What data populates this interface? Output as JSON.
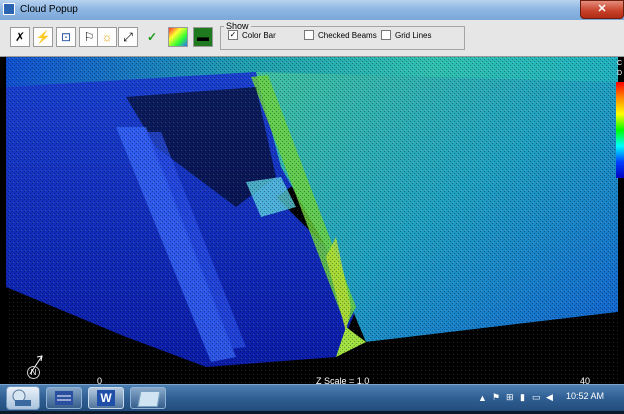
{
  "window": {
    "title": "Cloud Popup",
    "close_label": "✕"
  },
  "toolbar": {
    "buttons": [
      {
        "name": "cancel-tool-button",
        "glyph": "✗"
      },
      {
        "name": "flash-tool-button",
        "glyph": "⚡"
      },
      {
        "name": "identify-tool-button",
        "glyph": "⊡"
      },
      {
        "name": "flag-tool-button",
        "glyph": "⚐"
      },
      {
        "name": "sun-tool-button",
        "glyph": "☼"
      },
      {
        "name": "expand-tool-button",
        "glyph": "⤢"
      },
      {
        "name": "accept-tool-button",
        "glyph": "✓"
      },
      {
        "name": "color-ramp-tool-button",
        "glyph": "▦"
      },
      {
        "name": "band-tool-button",
        "glyph": "▬"
      }
    ],
    "show": {
      "legend": "Show",
      "color_bar": {
        "label": "Color Bar",
        "checked": true
      },
      "checked_beams": {
        "label": "Checked Beams",
        "checked": false
      },
      "grid_lines": {
        "label": "Grid Lines",
        "checked": false
      }
    }
  },
  "viewport": {
    "north_label": "N",
    "scale_label": "Z Scale = 1.0",
    "x_axis_left": "0",
    "x_axis_right": "40",
    "colorbar_header": [
      "C",
      "D"
    ],
    "colors": {
      "low": "#0000c0",
      "mid": "#00ffff",
      "high": "#ffff00",
      "top": "#ff0000"
    }
  },
  "taskbar": {
    "apps": [
      {
        "name": "taskbar-app-terrain"
      },
      {
        "name": "taskbar-app-chart"
      },
      {
        "name": "taskbar-app-word",
        "glyph": "W"
      },
      {
        "name": "taskbar-app-window"
      }
    ],
    "clock": "10:52 AM"
  }
}
